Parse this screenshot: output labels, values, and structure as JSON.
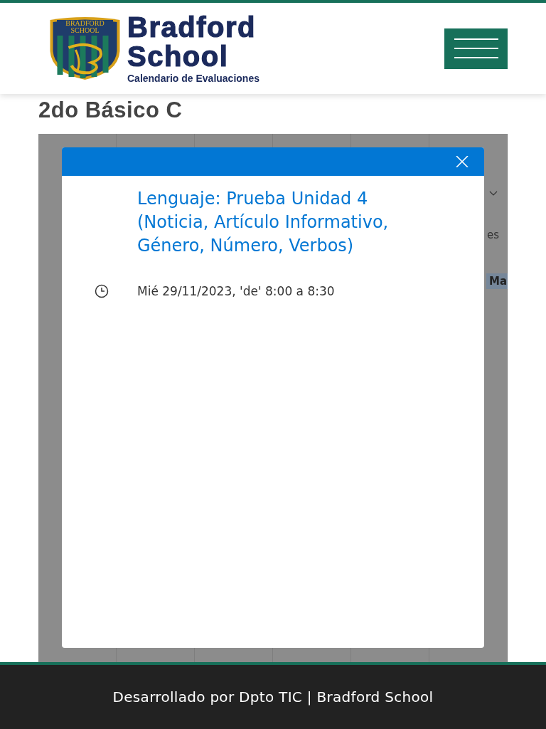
{
  "header": {
    "logo_shield_text": "BRADFORD SCHOOL",
    "logo_title_1": "Bradford",
    "logo_title_2": "School",
    "logo_subtitle": "Calendario de Evaluaciones"
  },
  "page_title": "2do Básico C",
  "calendar_fragments": [
    {
      "kind": "plain",
      "text": "es"
    },
    {
      "kind": "event",
      "text": "Ma"
    }
  ],
  "modal": {
    "title": "Lenguaje: Prueba Unidad 4 (Noticia, Artículo Informativo, Género, Número, Verbos)",
    "time": "Mié 29/11/2023, 'de' 8:00 a 8:30"
  },
  "footer": {
    "text": "Desarrollado por Dpto TIC | Bradford School"
  }
}
